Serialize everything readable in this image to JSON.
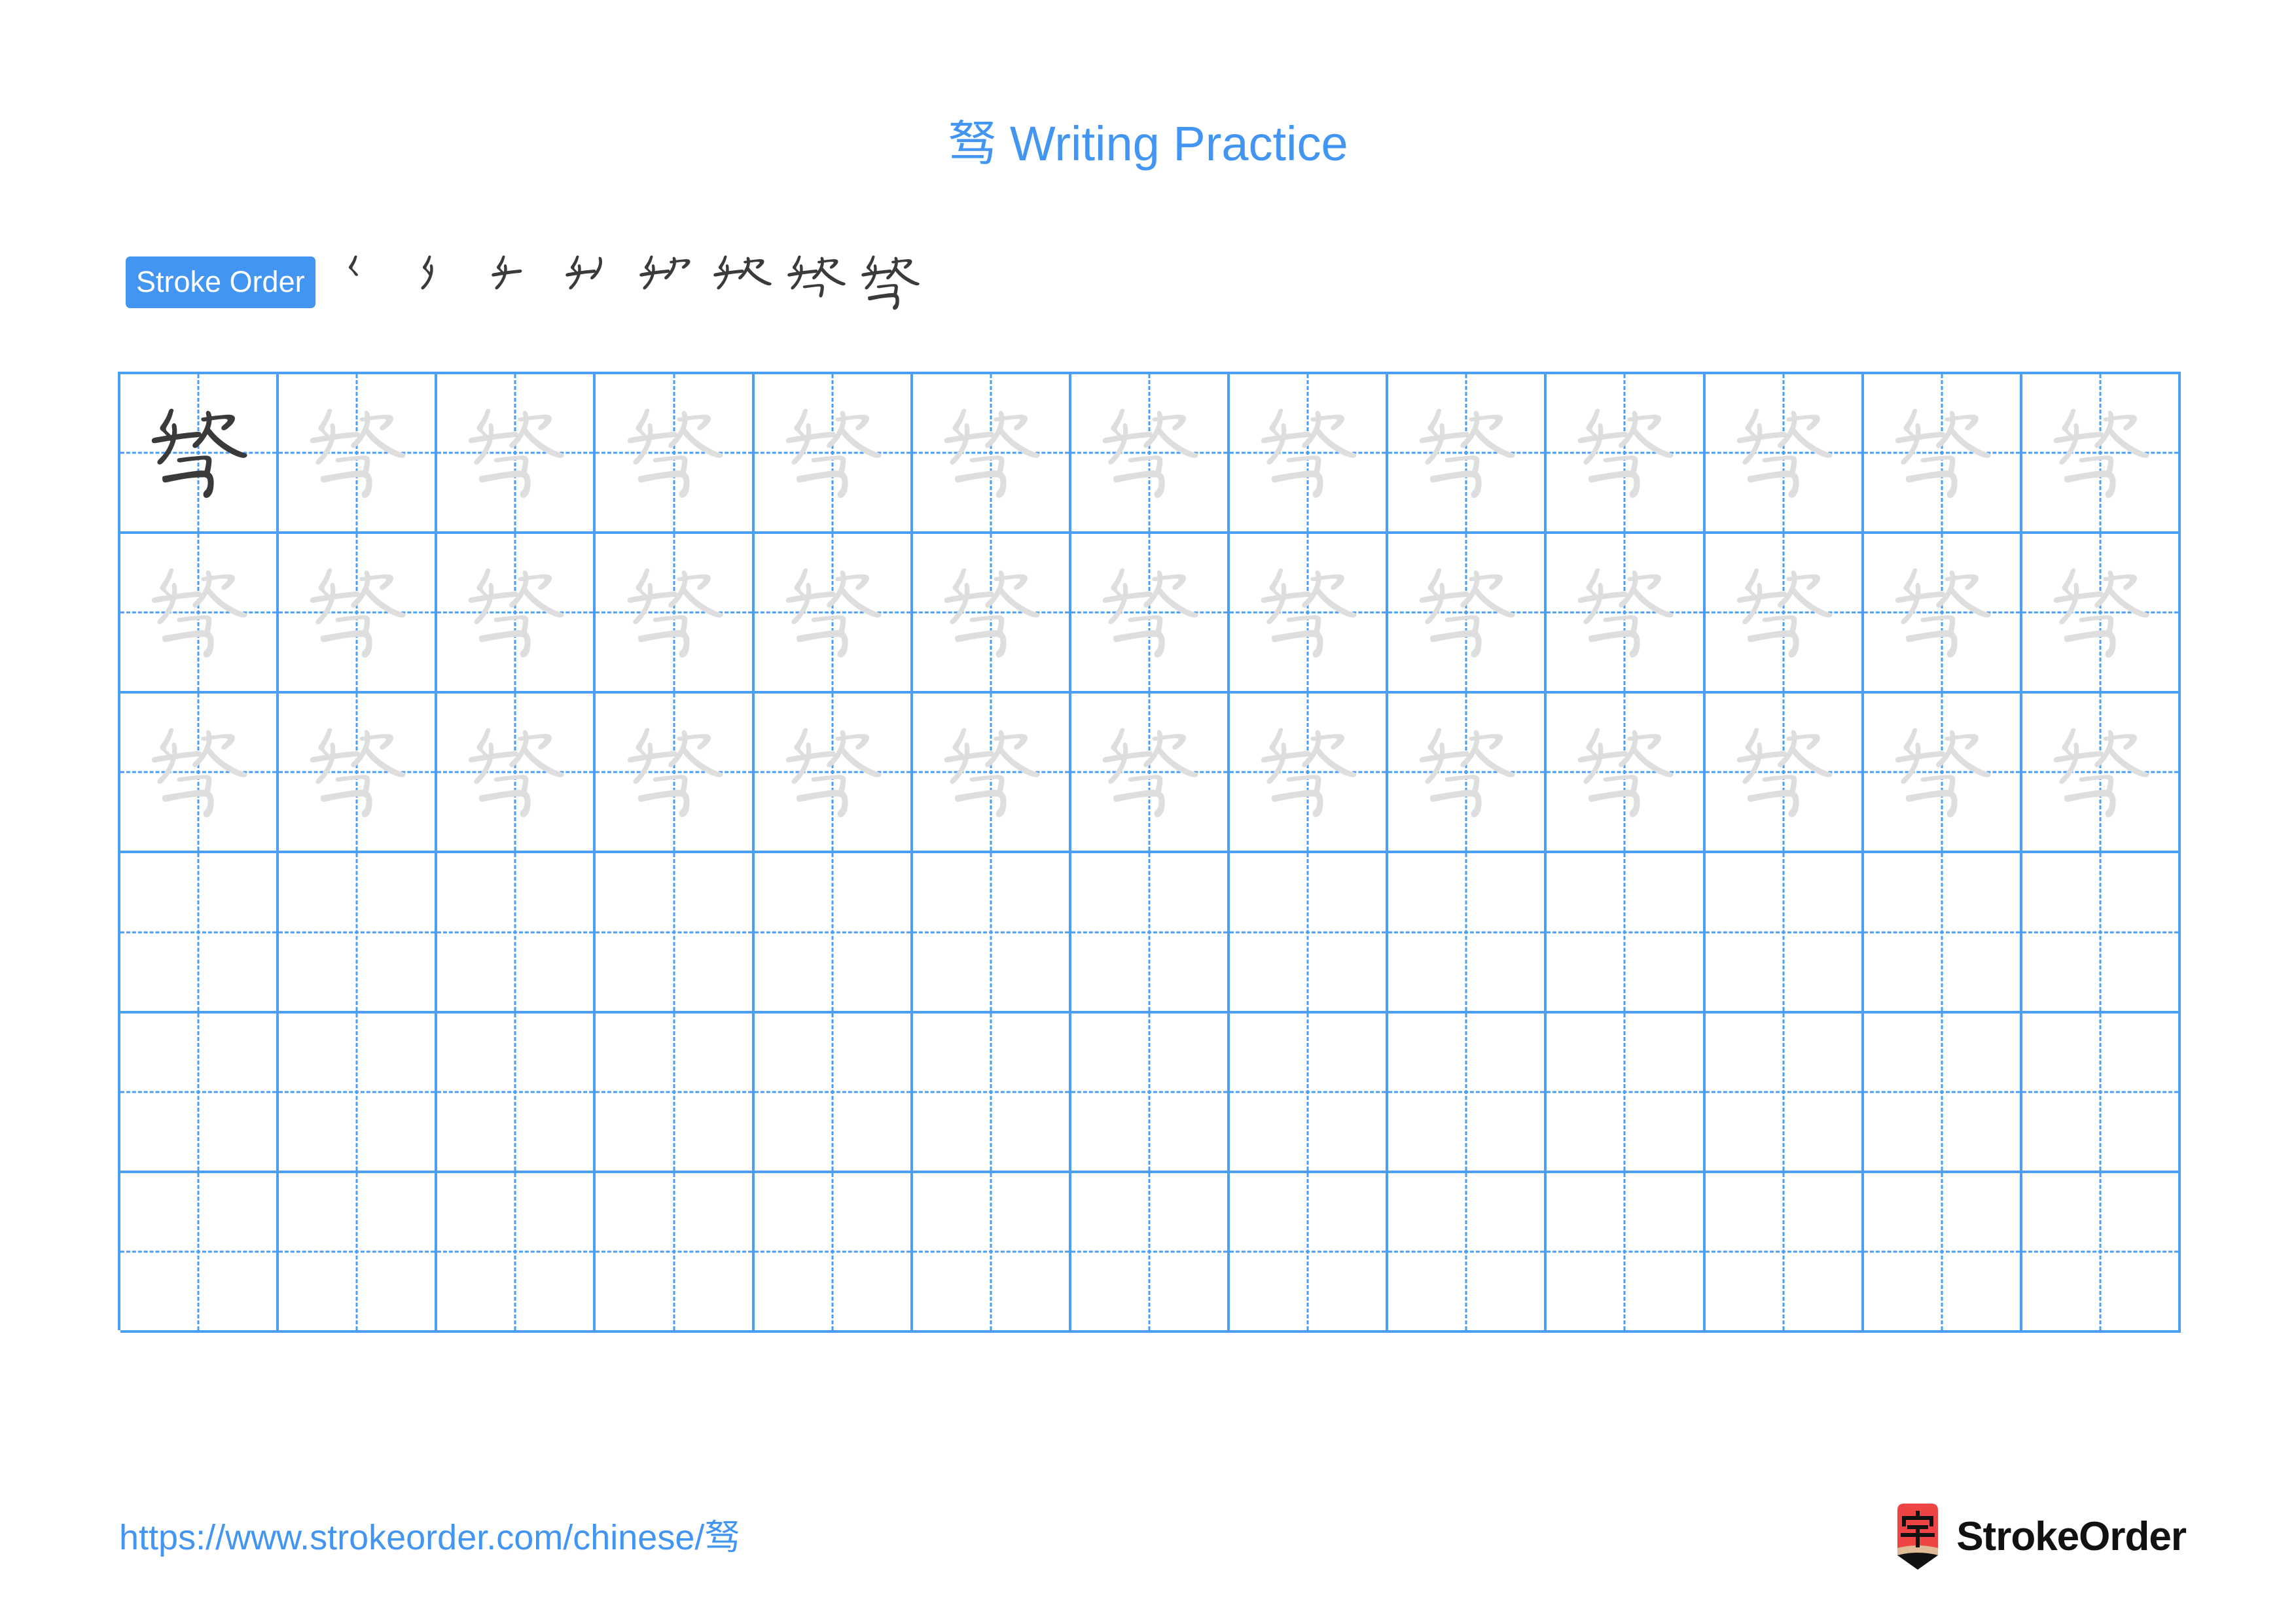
{
  "page": {
    "character": "驽",
    "title_text": "驽 Writing Practice",
    "title_character": "驽",
    "title_label": "Writing Practice",
    "background_color": "#ffffff",
    "accent_color": "#4295f0",
    "grid_line_color": "#4a9ff5",
    "traced_glyph_color": "#dedede",
    "ink_glyph_color": "#3a3a3a",
    "stroke_highlight_color": "#ee1c25"
  },
  "stroke_order": {
    "badge_label": "Stroke Order",
    "total_strokes": 8,
    "steps": [
      {
        "index": 1,
        "character": "驽",
        "strokes_shown": 1,
        "new_stroke_color": "#ee1c25"
      },
      {
        "index": 2,
        "character": "驽",
        "strokes_shown": 2,
        "new_stroke_color": "#ee1c25"
      },
      {
        "index": 3,
        "character": "驽",
        "strokes_shown": 3,
        "new_stroke_color": "#ee1c25"
      },
      {
        "index": 4,
        "character": "驽",
        "strokes_shown": 4,
        "new_stroke_color": "#ee1c25"
      },
      {
        "index": 5,
        "character": "驽",
        "strokes_shown": 5,
        "new_stroke_color": "#ee1c25"
      },
      {
        "index": 6,
        "character": "驽",
        "strokes_shown": 6,
        "new_stroke_color": "#ee1c25"
      },
      {
        "index": 7,
        "character": "驽",
        "strokes_shown": 7,
        "new_stroke_color": "#ee1c25"
      },
      {
        "index": 8,
        "character": "驽",
        "strokes_shown": 8,
        "new_stroke_color": "#ee1c25"
      }
    ]
  },
  "practice_grid": {
    "columns": 13,
    "rows": 6,
    "cells": [
      [
        "ink",
        "trace",
        "trace",
        "trace",
        "trace",
        "trace",
        "trace",
        "trace",
        "trace",
        "trace",
        "trace",
        "trace",
        "trace"
      ],
      [
        "trace",
        "trace",
        "trace",
        "trace",
        "trace",
        "trace",
        "trace",
        "trace",
        "trace",
        "trace",
        "trace",
        "trace",
        "trace"
      ],
      [
        "trace",
        "trace",
        "trace",
        "trace",
        "trace",
        "trace",
        "trace",
        "trace",
        "trace",
        "trace",
        "trace",
        "trace",
        "trace"
      ],
      [
        "empty",
        "empty",
        "empty",
        "empty",
        "empty",
        "empty",
        "empty",
        "empty",
        "empty",
        "empty",
        "empty",
        "empty",
        "empty"
      ],
      [
        "empty",
        "empty",
        "empty",
        "empty",
        "empty",
        "empty",
        "empty",
        "empty",
        "empty",
        "empty",
        "empty",
        "empty",
        "empty"
      ],
      [
        "empty",
        "empty",
        "empty",
        "empty",
        "empty",
        "empty",
        "empty",
        "empty",
        "empty",
        "empty",
        "empty",
        "empty",
        "empty"
      ]
    ]
  },
  "footer": {
    "url": "https://www.strokeorder.com/chinese/驽",
    "logo_text": "StrokeOrder",
    "logo_character": "字",
    "logo_body_color": "#ef4444",
    "logo_wood_color": "#e0bc96",
    "logo_tip_color": "#111111"
  }
}
